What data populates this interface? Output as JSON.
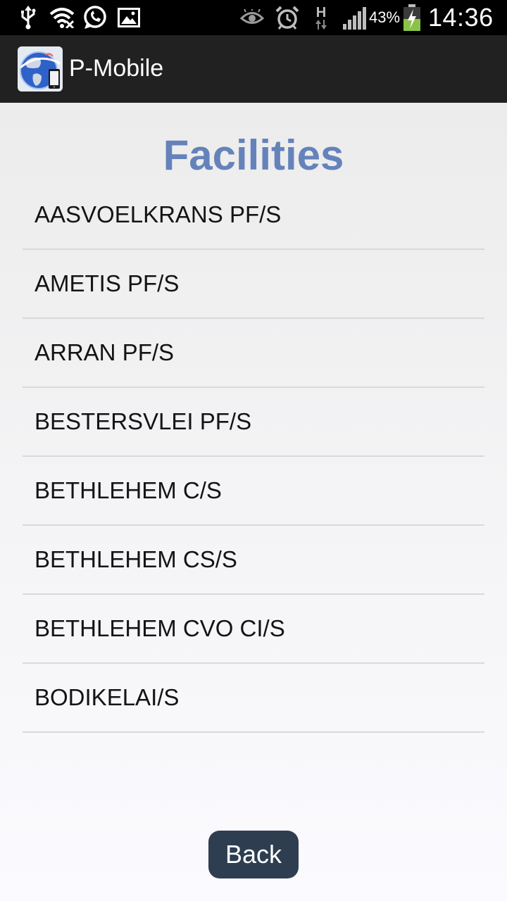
{
  "status_bar": {
    "icons_left": [
      "usb-icon",
      "wifi-icon",
      "whatsapp-icon",
      "gallery-icon"
    ],
    "icons_right": [
      "eye-icon",
      "alarm-icon",
      "network-h-icon",
      "signal-icon",
      "battery-charging-icon"
    ],
    "network_type": "H",
    "battery_percent": "43%",
    "time": "14:36"
  },
  "action_bar": {
    "app_icon": "p-mobile-globe-icon",
    "title": "P-Mobile"
  },
  "main": {
    "title": "Facilities",
    "facilities": [
      "AASVOELKRANS PF/S",
      "AMETIS PF/S",
      "ARRAN PF/S",
      "BESTERSVLEI PF/S",
      "BETHLEHEM C/S",
      "BETHLEHEM CS/S",
      "BETHLEHEM CVO CI/S",
      "BODIKELAI/S"
    ],
    "back_label": "Back"
  },
  "colors": {
    "title": "#6583ba",
    "action_bar": "#212121",
    "back_button": "#2e3e50"
  }
}
